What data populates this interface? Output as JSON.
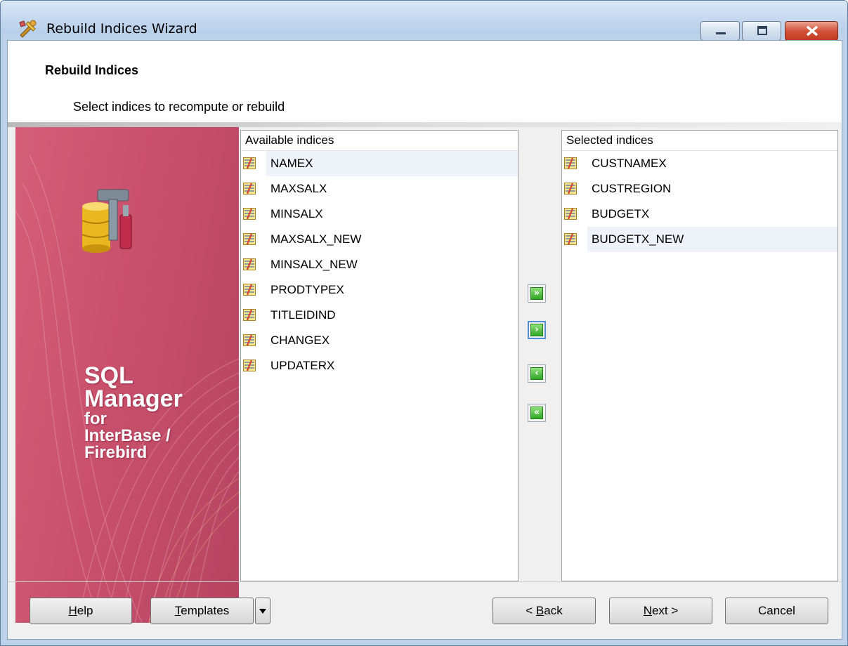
{
  "window": {
    "title": "Rebuild Indices Wizard",
    "icon": "wizard-tools-icon"
  },
  "header": {
    "title": "Rebuild Indices",
    "subtitle": "Select indices to recompute or rebuild"
  },
  "banner": {
    "line1": "SQL",
    "line2": "Manager",
    "line3": "for",
    "line4": "InterBase /",
    "line5": "Firebird"
  },
  "available": {
    "header": "Available indices",
    "items": [
      {
        "label": "NAMEX"
      },
      {
        "label": "MAXSALX"
      },
      {
        "label": "MINSALX"
      },
      {
        "label": "MAXSALX_NEW"
      },
      {
        "label": "MINSALX_NEW"
      },
      {
        "label": "PRODTYPEX"
      },
      {
        "label": "TITLEIDIND"
      },
      {
        "label": "CHANGEX"
      },
      {
        "label": "UPDATERX"
      }
    ]
  },
  "selected": {
    "header": "Selected indices",
    "items": [
      {
        "label": "CUSTNAMEX"
      },
      {
        "label": "CUSTREGION"
      },
      {
        "label": "BUDGETX"
      },
      {
        "label": "BUDGETX_NEW"
      }
    ]
  },
  "move_buttons": {
    "add_all": "»",
    "add": "›",
    "remove": "‹",
    "remove_all": "«"
  },
  "buttons": {
    "help": {
      "underline": "H",
      "rest": "elp"
    },
    "templates": {
      "underline": "T",
      "rest": "emplates"
    },
    "back": {
      "pre": "< ",
      "underline": "B",
      "rest": "ack"
    },
    "next": {
      "underline": "N",
      "rest": "ext >"
    },
    "cancel": "Cancel"
  },
  "colors": {
    "banner": "#c9506d",
    "titlebar": "#c3d7ee",
    "close": "#c23b20",
    "move_arrow": "#2fa624"
  }
}
